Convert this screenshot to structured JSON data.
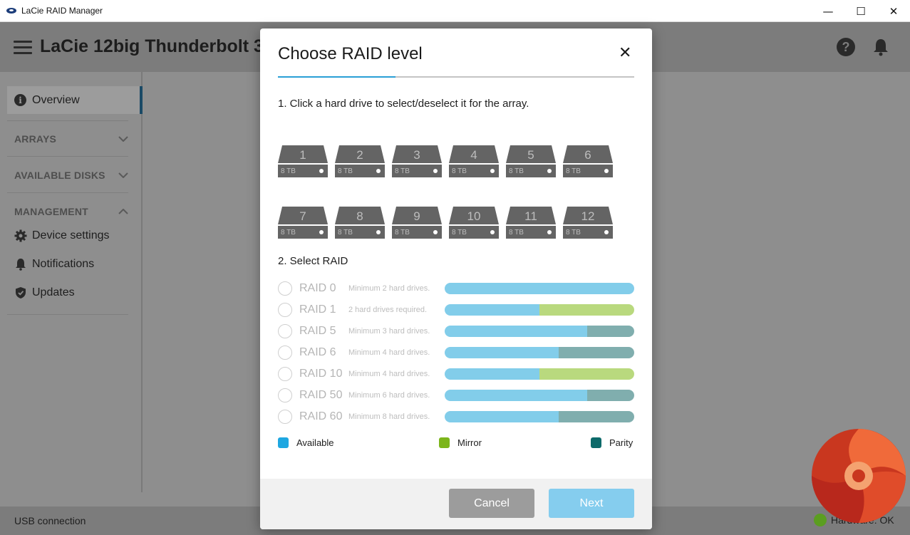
{
  "window": {
    "title": "LaCie RAID Manager",
    "controls": [
      "—",
      "☐",
      "✕"
    ]
  },
  "header": {
    "device_title": "LaCie 12big Thunderbolt 3"
  },
  "sidebar": {
    "overview": "Overview",
    "sections": {
      "arrays": "ARRAYS",
      "available_disks": "AVAILABLE DISKS",
      "management": "MANAGEMENT"
    },
    "items": [
      {
        "label": "Device settings",
        "icon": "gear-icon"
      },
      {
        "label": "Notifications",
        "icon": "bell-icon"
      },
      {
        "label": "Updates",
        "icon": "shield-icon"
      }
    ]
  },
  "footer": {
    "connection": "USB connection",
    "hardware_status": "Hardware: OK"
  },
  "modal": {
    "title": "Choose RAID level",
    "close": "✕",
    "step_progress": 0.33,
    "step1": "1. Click a hard drive to select/deselect it for the array.",
    "drives": [
      {
        "num": "1",
        "cap": "8 TB"
      },
      {
        "num": "2",
        "cap": "8 TB"
      },
      {
        "num": "3",
        "cap": "8 TB"
      },
      {
        "num": "4",
        "cap": "8 TB"
      },
      {
        "num": "5",
        "cap": "8 TB"
      },
      {
        "num": "6",
        "cap": "8 TB"
      },
      {
        "num": "7",
        "cap": "8 TB"
      },
      {
        "num": "8",
        "cap": "8 TB"
      },
      {
        "num": "9",
        "cap": "8 TB"
      },
      {
        "num": "10",
        "cap": "8 TB"
      },
      {
        "num": "11",
        "cap": "8 TB"
      },
      {
        "num": "12",
        "cap": "8 TB"
      }
    ],
    "step2": "2. Select RAID",
    "raid_options": [
      {
        "name": "RAID 0",
        "desc": "Minimum 2 hard drives.",
        "available": 1.0,
        "mirror": 0.0,
        "parity": 0.0
      },
      {
        "name": "RAID 1",
        "desc": "2 hard drives required.",
        "available": 0.5,
        "mirror": 0.5,
        "parity": 0.0
      },
      {
        "name": "RAID 5",
        "desc": "Minimum 3 hard drives.",
        "available": 0.75,
        "mirror": 0.0,
        "parity": 0.25
      },
      {
        "name": "RAID 6",
        "desc": "Minimum 4 hard drives.",
        "available": 0.6,
        "mirror": 0.0,
        "parity": 0.4
      },
      {
        "name": "RAID 10",
        "desc": "Minimum 4 hard drives.",
        "available": 0.5,
        "mirror": 0.5,
        "parity": 0.0
      },
      {
        "name": "RAID 50",
        "desc": "Minimum 6 hard drives.",
        "available": 0.75,
        "mirror": 0.0,
        "parity": 0.25
      },
      {
        "name": "RAID 60",
        "desc": "Minimum 8 hard drives.",
        "available": 0.6,
        "mirror": 0.0,
        "parity": 0.4
      }
    ],
    "legend": {
      "available": "Available",
      "mirror": "Mirror",
      "parity": "Parity"
    },
    "cancel_label": "Cancel",
    "next_label": "Next"
  },
  "colors": {
    "available_bar": "#82cdea",
    "mirror_bar": "#b9d97e",
    "parity_bar": "#80aeae",
    "available_swatch": "#1ea7e1",
    "mirror_swatch": "#7cb51b",
    "parity_swatch": "#0d6a6a",
    "accent": "#2a9fd6"
  }
}
